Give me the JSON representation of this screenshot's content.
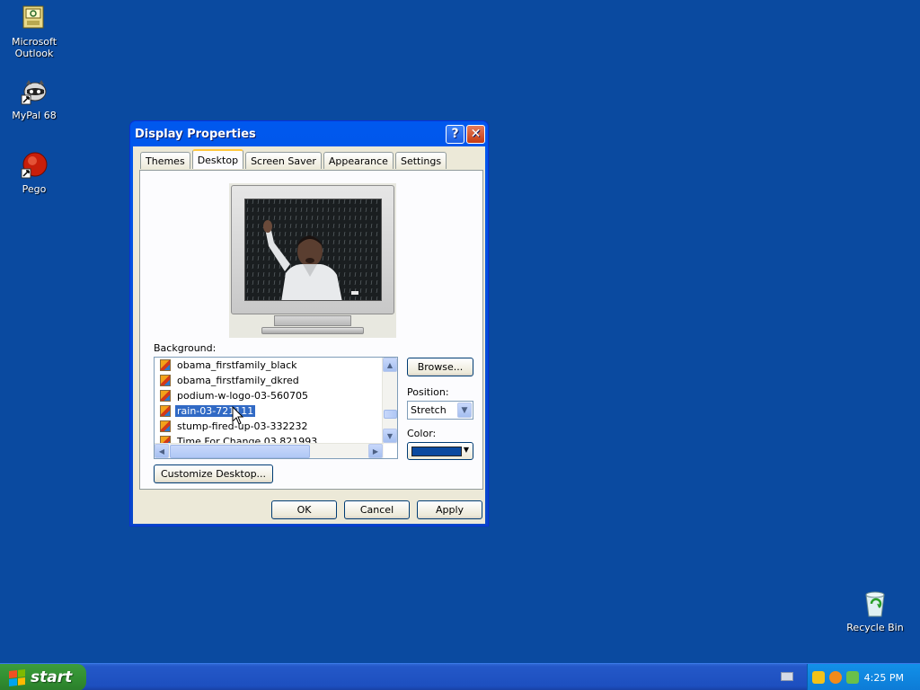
{
  "desktop": {
    "icons": [
      {
        "label_line1": "Microsoft",
        "label_line2": "Outlook"
      },
      {
        "label_line1": "MyPal 68",
        "label_line2": ""
      },
      {
        "label_line1": "Pego",
        "label_line2": ""
      },
      {
        "label_line1": "Recycle Bin",
        "label_line2": ""
      }
    ],
    "background_color": "#0a4aa0"
  },
  "window": {
    "title": "Display Properties",
    "help_glyph": "?",
    "close_glyph": "✕",
    "tabs": [
      {
        "label": "Themes"
      },
      {
        "label": "Desktop",
        "active": true
      },
      {
        "label": "Screen Saver"
      },
      {
        "label": "Appearance"
      },
      {
        "label": "Settings"
      }
    ],
    "background_label": "Background:",
    "background_items": [
      {
        "label": "obama_firstfamily_black"
      },
      {
        "label": "obama_firstfamily_dkred"
      },
      {
        "label": "podium-w-logo-03-560705"
      },
      {
        "label": "rain-03-721111",
        "selected": true
      },
      {
        "label": "stump-fired-up-03-332232"
      },
      {
        "label": "Time For Change 03 821993"
      }
    ],
    "browse_label": "Browse...",
    "position_label": "Position:",
    "position_value": "Stretch",
    "color_label": "Color:",
    "color_value": "#0a4aa0",
    "customize_label": "Customize Desktop...",
    "ok_label": "OK",
    "cancel_label": "Cancel",
    "apply_label": "Apply"
  },
  "taskbar": {
    "start_label": "start",
    "clock": "4:25 PM"
  }
}
